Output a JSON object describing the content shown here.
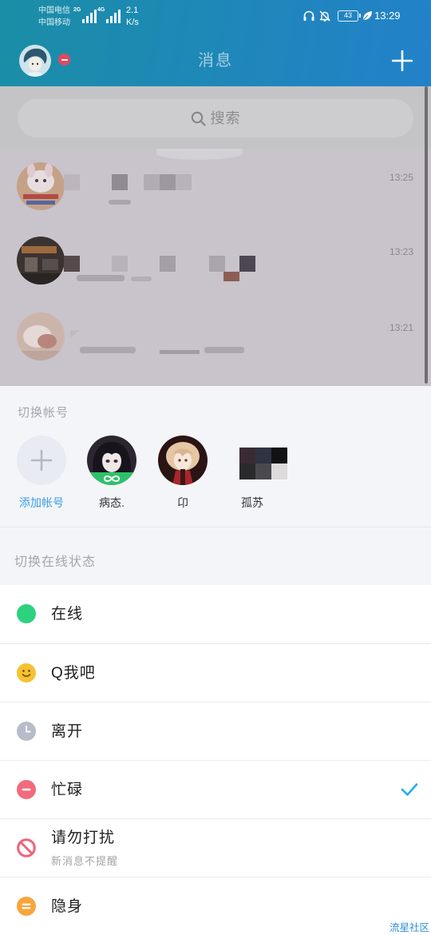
{
  "status_bar": {
    "carrier_1": "中国电信",
    "carrier_2": "中国移动",
    "network_1": "2G",
    "network_2": "4G",
    "speed_value": "2.1",
    "speed_unit": "K/s",
    "battery_level": "43",
    "time": "13:29",
    "icons": [
      "signal-bars-icon",
      "headphones-icon",
      "bell-muted-icon",
      "battery-icon",
      "leaf-icon"
    ]
  },
  "header": {
    "title": "消息",
    "badge_icon": "busy-badge-icon",
    "action_icon": "plus-icon"
  },
  "search": {
    "placeholder": "搜索",
    "icon": "search-icon"
  },
  "chat_list": [
    {
      "time": "13:25"
    },
    {
      "time": "13:23"
    },
    {
      "time": "13:21"
    }
  ],
  "account_switcher": {
    "title": "切换帐号",
    "accounts": [
      {
        "name": "添加帐号",
        "icon": "plus-icon"
      },
      {
        "name": "病态."
      },
      {
        "name": "卬"
      },
      {
        "name": "孤苏"
      }
    ]
  },
  "status_switcher": {
    "title": "切换在线状态",
    "options": [
      {
        "label": "在线",
        "icon": "online-icon",
        "color": "#2dd27f",
        "selected": false
      },
      {
        "label": "Q我吧",
        "icon": "smiley-icon",
        "color": "#f5c232",
        "selected": false
      },
      {
        "label": "离开",
        "icon": "clock-icon",
        "color": "#b6bdca",
        "selected": false
      },
      {
        "label": "忙碌",
        "icon": "busy-icon",
        "color": "#f26a7d",
        "selected": true
      },
      {
        "label": "请勿打扰",
        "sublabel": "新消息不提醒",
        "icon": "do-not-disturb-icon",
        "color": "#f06378",
        "selected": false
      },
      {
        "label": "隐身",
        "icon": "invisible-icon",
        "color": "#f7a53c",
        "selected": false
      }
    ]
  },
  "watermark": "流星社区",
  "colors": {
    "header_gradient": [
      "#1a8ea6",
      "#2381ca"
    ],
    "add_account_label": "#3b9de2",
    "check_accent": "#25aeea",
    "watermark": "#2b8fd8"
  }
}
